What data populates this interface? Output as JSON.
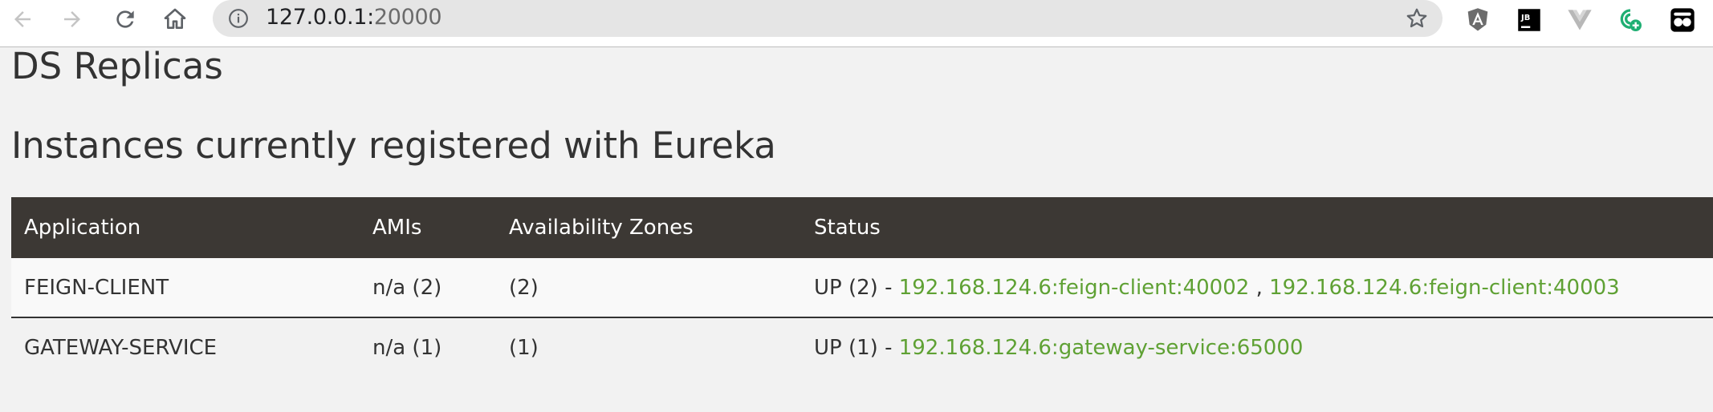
{
  "browser": {
    "url_host": "127.0.0.1:",
    "url_port": "20000",
    "extensions": [
      "angular-icon",
      "jetbrains-icon",
      "vue-icon",
      "add-extension-icon",
      "profile-icon"
    ]
  },
  "page": {
    "title_ds_replicas": "DS Replicas",
    "title_instances": "Instances currently registered with Eureka"
  },
  "table": {
    "headers": {
      "application": "Application",
      "amis": "AMIs",
      "zones": "Availability Zones",
      "status": "Status"
    },
    "rows": [
      {
        "application": "FEIGN-CLIENT",
        "amis": "n/a (2)",
        "zones": "(2)",
        "status_prefix": "UP (2) - ",
        "links": [
          "192.168.124.6:feign-client:40002",
          "192.168.124.6:feign-client:40003"
        ],
        "separator": " , "
      },
      {
        "application": "GATEWAY-SERVICE",
        "amis": "n/a (1)",
        "zones": "(1)",
        "status_prefix": "UP (1) - ",
        "links": [
          "192.168.124.6:gateway-service:65000"
        ]
      }
    ]
  },
  "colors": {
    "header_bg": "#3c3834",
    "link": "#5fa134",
    "page_bg": "#f2f2f2"
  }
}
